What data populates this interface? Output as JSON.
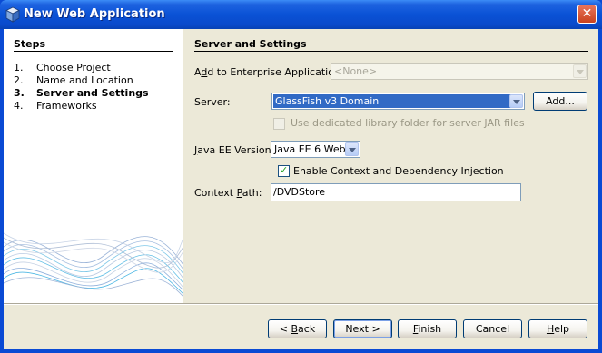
{
  "window": {
    "title": "New Web Application",
    "icons": {
      "app": "cube-icon",
      "close": "close-icon"
    }
  },
  "steps": {
    "title": "Steps",
    "items": [
      {
        "num": "1.",
        "label": "Choose Project",
        "active": false
      },
      {
        "num": "2.",
        "label": "Name and Location",
        "active": false
      },
      {
        "num": "3.",
        "label": "Server and Settings",
        "active": true
      },
      {
        "num": "4.",
        "label": "Frameworks",
        "active": false
      }
    ]
  },
  "panel": {
    "title": "Server and Settings",
    "enterprise": {
      "label_pre": "A",
      "label_mnemonic": "d",
      "label_post": "d to Enterprise Application:",
      "value": "<None>"
    },
    "server": {
      "label": "Server:",
      "value": "GlassFish v3 Domain",
      "add_label": "Add..."
    },
    "dedicated_lib": {
      "label": "Use dedicated library folder for server JAR files",
      "checked": false
    },
    "javaee": {
      "label_mnemonic": "J",
      "label_post": "ava EE Version:",
      "value": "Java EE 6 Web"
    },
    "cdi": {
      "label": "Enable Context and Dependency Injection",
      "checked": true
    },
    "context_path": {
      "label_pre": "Context ",
      "label_mnemonic": "P",
      "label_post": "ath:",
      "value": "/DVDStore"
    }
  },
  "buttons": {
    "back": {
      "pre": "< ",
      "mnemonic": "B",
      "post": "ack"
    },
    "next": {
      "pre": "Next ",
      "mnemonic": "",
      "post": ">"
    },
    "finish": {
      "mnemonic": "F",
      "post": "inish"
    },
    "cancel": {
      "label": "Cancel"
    },
    "help": {
      "mnemonic": "H",
      "post": "elp"
    }
  },
  "colors": {
    "titlebar": "#0A52D6",
    "selection": "#316AC5",
    "check": "#21A121"
  }
}
